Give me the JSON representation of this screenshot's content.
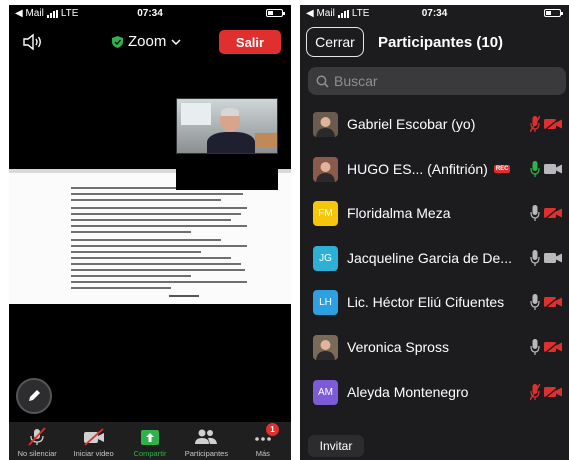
{
  "left_screen": {
    "status": {
      "carrier": "◀ Mail",
      "network": "LTE",
      "time": "07:34"
    },
    "header": {
      "title": "Zoom",
      "exit_label": "Salir"
    },
    "toolbar": [
      {
        "label": "No silenciar",
        "icon": "mic-muted-icon"
      },
      {
        "label": "Iniciar video",
        "icon": "video-off-icon"
      },
      {
        "label": "Compartir",
        "icon": "share-screen-icon"
      },
      {
        "label": "Participantes",
        "icon": "participants-icon"
      },
      {
        "label": "Más",
        "icon": "more-icon",
        "badge": "1"
      }
    ]
  },
  "right_screen": {
    "status": {
      "carrier": "◀ Mail",
      "network": "LTE",
      "time": "07:34"
    },
    "header": {
      "close_label": "Cerrar",
      "title": "Participantes (10)"
    },
    "search": {
      "placeholder": "Buscar"
    },
    "participants": [
      {
        "name": "Gabriel Escobar (yo)",
        "avatar_type": "photo",
        "avatar_text": "",
        "avatar_color": "#6b5a4e",
        "mic": "muted",
        "video": "off",
        "rec": ""
      },
      {
        "name": "HUGO ES...  (Anfitrión)",
        "avatar_type": "photo",
        "avatar_text": "",
        "avatar_color": "#8a5a4a",
        "mic": "on",
        "video": "on",
        "rec": "REC"
      },
      {
        "name": "Floridalma Meza",
        "avatar_type": "initials",
        "avatar_text": "FM",
        "avatar_color": "#f5c60c",
        "mic": "on",
        "video": "off",
        "rec": ""
      },
      {
        "name": "Jacqueline Garcia de De...",
        "avatar_type": "initials",
        "avatar_text": "JG",
        "avatar_color": "#2cb0d6",
        "mic": "on",
        "video": "on",
        "rec": ""
      },
      {
        "name": "Lic. Héctor Eliú Cifuentes",
        "avatar_type": "initials",
        "avatar_text": "LH",
        "avatar_color": "#2ca0e0",
        "mic": "on",
        "video": "off",
        "rec": ""
      },
      {
        "name": "Veronica Spross",
        "avatar_type": "photo",
        "avatar_text": "",
        "avatar_color": "#7a6a5a",
        "mic": "on",
        "video": "off",
        "rec": ""
      },
      {
        "name": "Aleyda Montenegro",
        "avatar_type": "initials",
        "avatar_text": "AM",
        "avatar_color": "#7c5bd8",
        "mic": "muted",
        "video": "off",
        "rec": ""
      }
    ],
    "invite_label": "Invitar"
  },
  "colors": {
    "red": "#e02f2f",
    "green": "#2fb24c",
    "mic_gray": "#b9b9b9"
  }
}
